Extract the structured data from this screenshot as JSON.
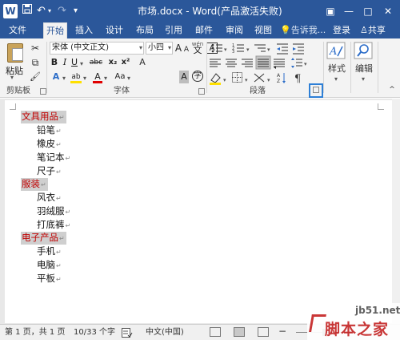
{
  "titlebar": {
    "logo": "W",
    "title": "市场.docx - Word(产品激活失败)",
    "quick_access": {
      "save_icon": "save-icon",
      "undo_icon": "undo-icon",
      "redo_icon": "redo-icon",
      "customize_icon": "customize-icon"
    },
    "window": {
      "help": "?",
      "restore_ribbon": "▣",
      "minimize": "—",
      "maximize": "□",
      "close": "✕"
    }
  },
  "tabs": [
    {
      "label": "文件"
    },
    {
      "label": "开始",
      "active": true
    },
    {
      "label": "插入"
    },
    {
      "label": "设计"
    },
    {
      "label": "布局"
    },
    {
      "label": "引用"
    },
    {
      "label": "邮件"
    },
    {
      "label": "审阅"
    },
    {
      "label": "视图"
    }
  ],
  "tellme": {
    "icon": "lightbulb-icon",
    "label": "告诉我..."
  },
  "login": "登录",
  "share": {
    "icon": "person-icon",
    "label": "共享"
  },
  "ribbon": {
    "clipboard": {
      "label": "剪贴板",
      "paste": "粘贴",
      "cut": "✂",
      "copy": "⧉",
      "format_painter": "🖌"
    },
    "font": {
      "label": "字体",
      "font_name": "宋体 (中文正文)",
      "font_size": "小四",
      "grow": "A",
      "shrink": "A",
      "change_case": "Aa",
      "clear_format": "A",
      "wen": "wén",
      "wen_char": "文",
      "A_box": "A",
      "bold": "B",
      "italic": "I",
      "underline": "U",
      "strike": "abc",
      "subscript": "x₂",
      "superscript": "x²",
      "text_effect": "A",
      "highlight": "ab",
      "font_color": "A",
      "char_shading": "A",
      "enclose": "字"
    },
    "paragraph": {
      "label": "段落"
    },
    "styles": {
      "label": "样式"
    },
    "editing": {
      "label": "编辑"
    }
  },
  "colors": {
    "title_bar": "#2b579a",
    "heading_text": "#c00000",
    "heading_bg": "#cfcfcf",
    "highlight_yellow": "#ffe000",
    "font_red": "#e00000",
    "launcher_box": "#2e7fd6"
  },
  "document": {
    "lines": [
      {
        "text": "文具用品",
        "heading": true
      },
      {
        "text": "铅笔",
        "heading": false
      },
      {
        "text": "橡皮",
        "heading": false
      },
      {
        "text": "笔记本",
        "heading": false
      },
      {
        "text": "尺子",
        "heading": false
      },
      {
        "text": "服装",
        "heading": true
      },
      {
        "text": "风衣",
        "heading": false
      },
      {
        "text": "羽绒服",
        "heading": false
      },
      {
        "text": "打底裤",
        "heading": false
      },
      {
        "text": "电子产品",
        "heading": true
      },
      {
        "text": "手机",
        "heading": false
      },
      {
        "text": "电脑",
        "heading": false
      },
      {
        "text": "平板",
        "heading": false
      }
    ],
    "para_mark": "↵"
  },
  "status": {
    "page": "第 1 页，共 1 页",
    "words": "10/33 个字",
    "lang": "中文(中国)"
  },
  "watermark": {
    "site": "jb51.net",
    "text": "脚本之家"
  }
}
